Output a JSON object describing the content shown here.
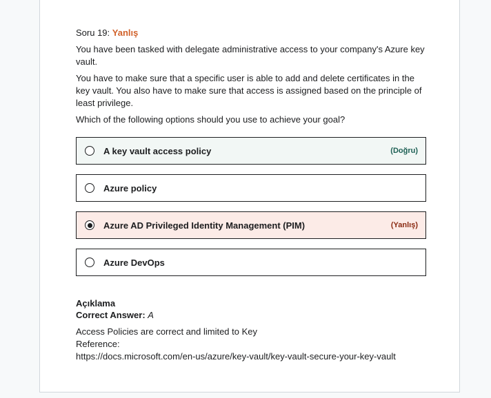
{
  "question": {
    "number_label": "Soru 19:",
    "status": "Yanlış",
    "paragraphs": [
      "You have been tasked with delegate administrative access to your company's Azure key vault.",
      "You have to make sure that a specific user is able to add and delete certificates in the key vault. You also have to make sure that access is assigned based on the principle of least privilege.",
      "Which of the following options should you use to achieve your goal?"
    ]
  },
  "options": [
    {
      "label": "A key vault access policy",
      "tag": "(Doğru)",
      "state": "correct",
      "selected": false
    },
    {
      "label": "Azure policy",
      "tag": "",
      "state": "neutral",
      "selected": false
    },
    {
      "label": "Azure AD Privileged Identity Management (PIM)",
      "tag": "(Yanlış)",
      "state": "wrong",
      "selected": true
    },
    {
      "label": "Azure DevOps",
      "tag": "",
      "state": "neutral",
      "selected": false
    }
  ],
  "explanation": {
    "title": "Açıklama",
    "correct_answer_label": "Correct Answer:",
    "correct_answer_value": "A",
    "lines": [
      "Access Policies are correct and limited to Key",
      "Reference:",
      "https://docs.microsoft.com/en-us/azure/key-vault/key-vault-secure-your-key-vault"
    ]
  },
  "colors": {
    "status_wrong": "#d1622b",
    "correct_bg": "#f2f7f5",
    "wrong_bg": "#fcebe7"
  }
}
